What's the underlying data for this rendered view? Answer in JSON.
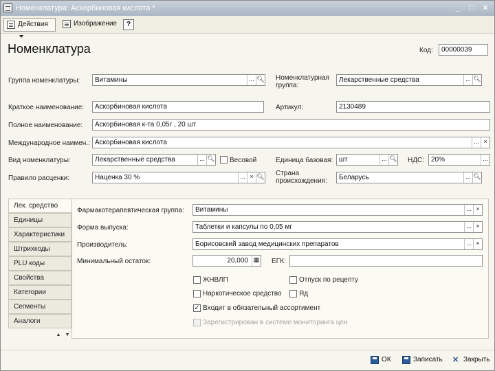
{
  "window": {
    "title": "Номенклатура: Аскорбиновая кислота *",
    "controls": [
      "_",
      "□",
      "×"
    ]
  },
  "toolbar": {
    "actions_label": "Действия",
    "image_label": "Изображение",
    "help_label": "?"
  },
  "header": {
    "title": "Номенклатура",
    "code_label": "Код:",
    "code_value": "00000039"
  },
  "fields": {
    "group_label": "Группа номенклатуры:",
    "group_value": "Витамины",
    "nom_group_label": "Номенклатурная группа:",
    "nom_group_value": "Лекарственные средства",
    "short_name_label": "Краткое наименование:",
    "short_name_value": "Аскорбиновая кислота",
    "article_label": "Артикул:",
    "article_value": "2130489",
    "full_name_label": "Полное наименование:",
    "full_name_value": "Аскорбиновая к-та 0,05г , 20 шт",
    "intl_name_label": "Международное наимен.:",
    "intl_name_value": "Аскорбиновая кислота",
    "kind_label": "Вид номенклатуры:",
    "kind_value": "Лекарственные средства",
    "weight_label": "Весовой",
    "unit_label": "Единица базовая:",
    "unit_value": "шт",
    "vat_label": "НДС:",
    "vat_value": "20%",
    "pricing_label": "Правило расценки:",
    "pricing_value": "Наценка 30 %",
    "country_label": "Страна происхождения:",
    "country_value": "Беларусь"
  },
  "tabs": [
    {
      "label": "Лек. средство"
    },
    {
      "label": "Единицы"
    },
    {
      "label": "Характеристики"
    },
    {
      "label": "Штрихкоды"
    },
    {
      "label": "PLU коды"
    },
    {
      "label": "Свойства"
    },
    {
      "label": "Категории"
    },
    {
      "label": "Сегменты"
    },
    {
      "label": "Аналоги"
    }
  ],
  "panel": {
    "pharm_group_label": "Фармакотерапевтическая группа:",
    "pharm_group_value": "Витамины",
    "form_label": "Форма выпуска:",
    "form_value": "Таблетки и капсулы по 0,05 мг",
    "maker_label": "Производитель:",
    "maker_value": "Борисовский завод медицинских препаратов",
    "min_stock_label": "Минимальный остаток:",
    "min_stock_value": "20,000",
    "egk_label": "ЕГК:",
    "egk_value": "",
    "jnvlp_label": "ЖНВЛП",
    "prescription_label": "Отпуск по рецепту",
    "narcotic_label": "Наркотическое средство",
    "poison_label": "Яд",
    "mandatory_label": "Входит в обязательный ассортимент",
    "monitoring_label": "Зарегистрирован в системе мониторинга цен"
  },
  "buttons": {
    "ok_label": "ОК",
    "save_label": "Записать",
    "close_label": "Закрыть"
  }
}
